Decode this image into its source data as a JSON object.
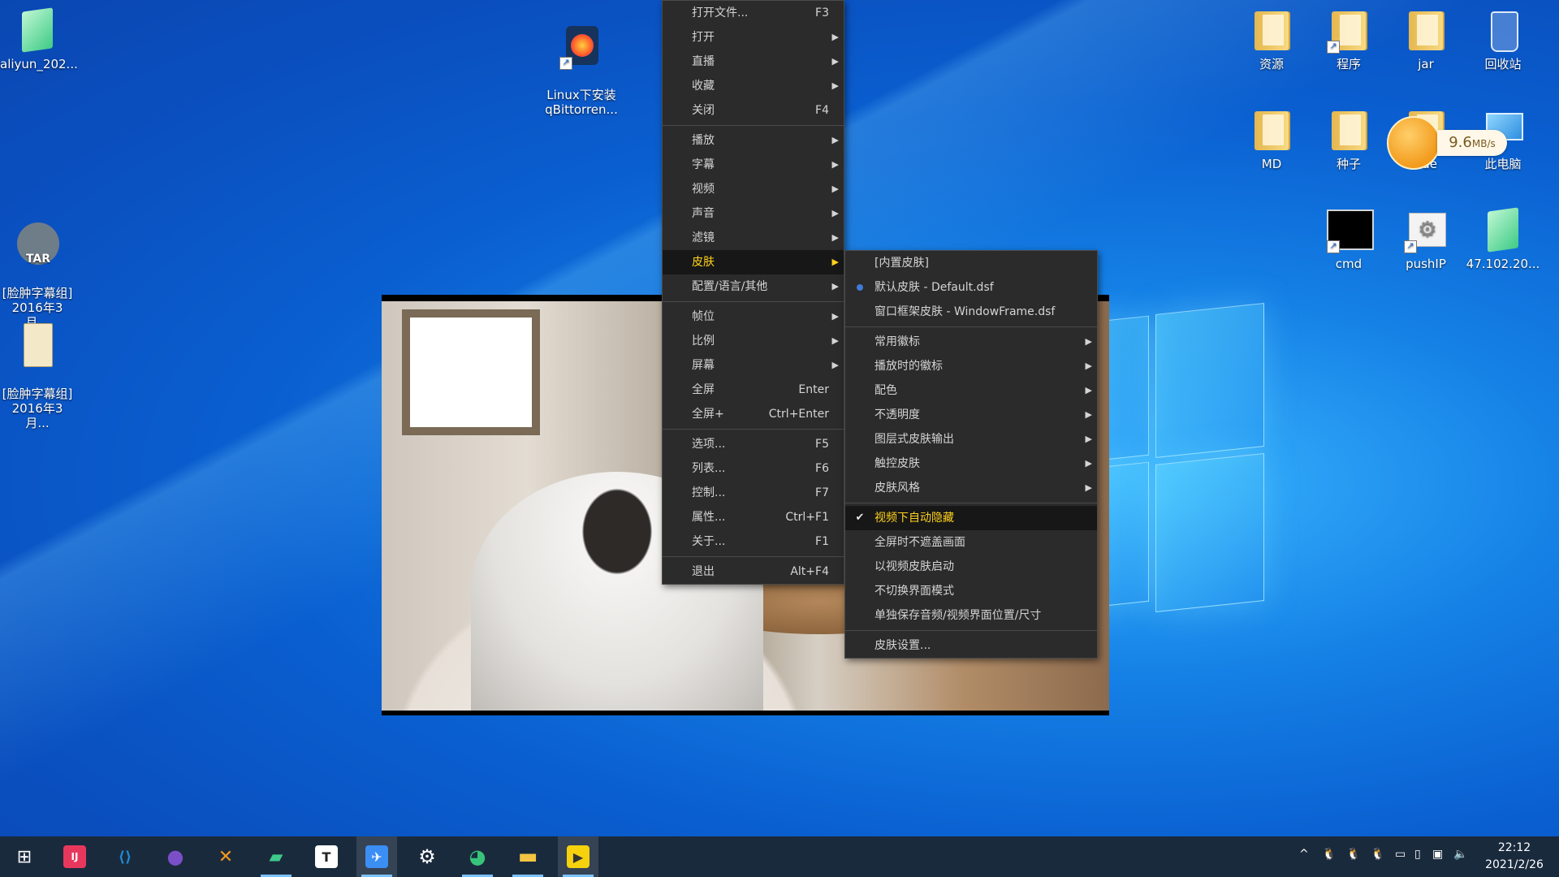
{
  "desktop": {
    "left_icons": [
      {
        "label": "aliyun_202...",
        "icon": "green-document-icon"
      },
      {
        "label": "[脸肿字幕组]\n2016年3月...",
        "icon": "tar-archive-icon"
      },
      {
        "label": "[脸肿字幕组]\n2016年3月...",
        "icon": "tar-file-icon"
      }
    ],
    "center_icon": {
      "label": "Linux下安装\nqBittorren...",
      "icon": "firefox-icon"
    },
    "right_icons": [
      {
        "label": "资源",
        "icon": "folder-icon"
      },
      {
        "label": "程序",
        "icon": "folder-icon"
      },
      {
        "label": "jar",
        "icon": "folder-icon"
      },
      {
        "label": "回收站",
        "icon": "recycle-bin-icon"
      },
      {
        "label": "MD",
        "icon": "folder-icon"
      },
      {
        "label": "种子",
        "icon": "folder-icon"
      },
      {
        "label": "ode",
        "icon": "folder-icon"
      },
      {
        "label": "此电脑",
        "icon": "computer-icon"
      },
      {
        "label": "cmd",
        "icon": "terminal-icon"
      },
      {
        "label": "pushIP",
        "icon": "settings-doc-icon"
      },
      {
        "label": "47.102.20...",
        "icon": "green-document-icon"
      }
    ]
  },
  "speed_widget": {
    "value": "9.6",
    "unit": "MB/s"
  },
  "main_menu": {
    "items": [
      {
        "label": "打开文件...",
        "shortcut": "F3"
      },
      {
        "label": "打开",
        "arrow": "▶"
      },
      {
        "label": "直播",
        "arrow": "▶"
      },
      {
        "label": "收藏",
        "arrow": "▶"
      },
      {
        "label": "关闭",
        "shortcut": "F4"
      },
      {
        "label": "播放",
        "arrow": "▶"
      },
      {
        "label": "字幕",
        "arrow": "▶"
      },
      {
        "label": "视频",
        "arrow": "▶"
      },
      {
        "label": "声音",
        "arrow": "▶"
      },
      {
        "label": "滤镜",
        "arrow": "▶"
      },
      {
        "label": "皮肤",
        "arrow": "▶"
      },
      {
        "label": "配置/语言/其他",
        "arrow": "▶"
      },
      {
        "label": "帧位",
        "arrow": "▶"
      },
      {
        "label": "比例",
        "arrow": "▶"
      },
      {
        "label": "屏幕",
        "arrow": "▶"
      },
      {
        "label": "全屏",
        "shortcut": "Enter"
      },
      {
        "label": "全屏+",
        "shortcut": "Ctrl+Enter"
      },
      {
        "label": "选项...",
        "shortcut": "F5"
      },
      {
        "label": "列表...",
        "shortcut": "F6"
      },
      {
        "label": "控制...",
        "shortcut": "F7"
      },
      {
        "label": "属性...",
        "shortcut": "Ctrl+F1"
      },
      {
        "label": "关于...",
        "shortcut": "F1"
      },
      {
        "label": "退出",
        "shortcut": "Alt+F4"
      }
    ]
  },
  "skin_menu": {
    "items": [
      {
        "label": "[内置皮肤]"
      },
      {
        "label": "默认皮肤 - Default.dsf"
      },
      {
        "label": "窗口框架皮肤 - WindowFrame.dsf"
      },
      {
        "label": "常用徽标",
        "arrow": "▶"
      },
      {
        "label": "播放时的徽标",
        "arrow": "▶"
      },
      {
        "label": "配色",
        "arrow": "▶"
      },
      {
        "label": "不透明度",
        "arrow": "▶"
      },
      {
        "label": "图层式皮肤输出",
        "arrow": "▶"
      },
      {
        "label": "触控皮肤",
        "arrow": "▶"
      },
      {
        "label": "皮肤风格",
        "arrow": "▶"
      },
      {
        "label": "视频下自动隐藏",
        "check": "✔"
      },
      {
        "label": "全屏时不遮盖画面"
      },
      {
        "label": "以视频皮肤启动"
      },
      {
        "label": "不切换界面模式"
      },
      {
        "label": "单独保存音频/视频界面位置/尺寸"
      },
      {
        "label": "皮肤设置..."
      }
    ]
  },
  "taskbar": {
    "start_glyph": "⊞",
    "apps": [
      {
        "name": "IntelliJ IDEA",
        "glyph": "IJ",
        "color": "#e8375d"
      },
      {
        "name": "VS Code",
        "glyph": "⟨⟩",
        "color": "#1f8ad2"
      },
      {
        "name": "GitHub Desktop",
        "glyph": "●",
        "color": "#7b4fc8"
      },
      {
        "name": "Xshell",
        "glyph": "✕",
        "color": "#f39a1e"
      },
      {
        "name": "Notepad",
        "glyph": "▰",
        "color": "#3ec98a"
      },
      {
        "name": "Typora",
        "glyph": "T",
        "color": "#ffffff"
      },
      {
        "name": "Feishu",
        "glyph": "✈",
        "color": "#3b8ef3"
      },
      {
        "name": "Settings",
        "glyph": "⚙",
        "color": "#ffffff"
      },
      {
        "name": "Browser",
        "glyph": "◕",
        "color": "#37c37a"
      },
      {
        "name": "File Explorer",
        "glyph": "▬",
        "color": "#f4c542"
      },
      {
        "name": "PotPlayer",
        "glyph": "▶",
        "color": "#f5d10e"
      }
    ],
    "clock": {
      "time": "22:12",
      "date": "2021/2/26"
    },
    "tray_glyphs": [
      "^",
      "🐧",
      "🐧",
      "🐧",
      "▭",
      "▯",
      "▣",
      "🔈"
    ]
  }
}
